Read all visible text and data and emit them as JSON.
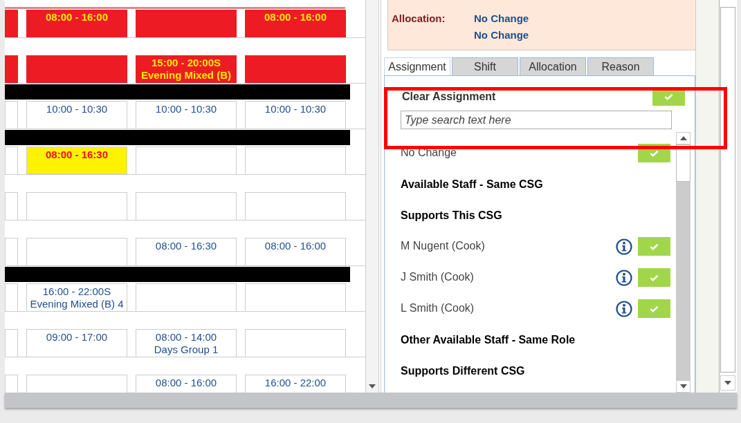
{
  "schedule": {
    "rows": [
      {
        "kind": "shift",
        "cells": [
          {
            "kind": "red"
          },
          {
            "kind": "red",
            "lines": [
              "08:00 - 16:00"
            ]
          },
          {
            "kind": "red"
          },
          {
            "kind": "red",
            "lines": [
              "08:00 - 16:00"
            ]
          }
        ]
      },
      {
        "kind": "shift",
        "cells": [
          {
            "kind": "red"
          },
          {
            "kind": "red"
          },
          {
            "kind": "red",
            "lines": [
              "15:00 - 20:00S",
              "Evening Mixed (B)"
            ]
          },
          {
            "kind": "red"
          }
        ]
      },
      {
        "kind": "divider"
      },
      {
        "kind": "shift",
        "cells": [
          {
            "kind": "plain"
          },
          {
            "kind": "plain",
            "lines": [
              "10:00 - 10:30"
            ]
          },
          {
            "kind": "plain",
            "lines": [
              "10:00 - 10:30"
            ]
          },
          {
            "kind": "plain",
            "lines": [
              "10:00 - 10:30"
            ]
          }
        ]
      },
      {
        "kind": "divider"
      },
      {
        "kind": "shift",
        "cells": [
          {
            "kind": "plain"
          },
          {
            "kind": "yellow",
            "lines": [
              "08:00 - 16:30"
            ]
          },
          {
            "kind": "plain"
          },
          {
            "kind": "plain"
          }
        ]
      },
      {
        "kind": "shift",
        "cells": [
          {
            "kind": "plain"
          },
          {
            "kind": "plain"
          },
          {
            "kind": "plain"
          },
          {
            "kind": "plain"
          }
        ]
      },
      {
        "kind": "shift",
        "cells": [
          {
            "kind": "plain"
          },
          {
            "kind": "plain"
          },
          {
            "kind": "plain",
            "lines": [
              "08:00 - 16:30"
            ]
          },
          {
            "kind": "plain",
            "lines": [
              "08:00 - 16:00"
            ]
          }
        ]
      },
      {
        "kind": "divider"
      },
      {
        "kind": "shift",
        "cells": [
          {
            "kind": "plain"
          },
          {
            "kind": "plain",
            "lines": [
              "16:00 - 22:00S",
              "Evening Mixed (B) 4"
            ]
          },
          {
            "kind": "plain"
          },
          {
            "kind": "plain"
          }
        ]
      },
      {
        "kind": "shift",
        "cells": [
          {
            "kind": "plain"
          },
          {
            "kind": "plain",
            "lines": [
              "09:00 - 17:00"
            ]
          },
          {
            "kind": "plain",
            "lines": [
              "08:00 - 14:00",
              "Days Group 1"
            ]
          },
          {
            "kind": "plain"
          }
        ]
      },
      {
        "kind": "shift",
        "cells": [
          {
            "kind": "plain"
          },
          {
            "kind": "plain"
          },
          {
            "kind": "plain",
            "lines": [
              "08:00 - 16:00"
            ]
          },
          {
            "kind": "plain",
            "lines": [
              "16:00 - 22:00"
            ]
          }
        ]
      }
    ]
  },
  "details": {
    "label": "Allocation:",
    "values": [
      "No Change",
      "No Change"
    ]
  },
  "tabs": [
    {
      "label": "Assignment",
      "selected": true
    },
    {
      "label": "Shift",
      "selected": false
    },
    {
      "label": "Allocation",
      "selected": false
    },
    {
      "label": "Reason",
      "selected": false
    }
  ],
  "assignment": {
    "title": "Clear Assignment",
    "search": {
      "placeholder": "Type search text here"
    },
    "items": [
      {
        "kind": "option",
        "label": "No Change"
      },
      {
        "kind": "heading",
        "label": "Available Staff - Same CSG"
      },
      {
        "kind": "heading",
        "label": "Supports This CSG"
      },
      {
        "kind": "staff",
        "label": "M Nugent (Cook)"
      },
      {
        "kind": "staff",
        "label": "J Smith (Cook)"
      },
      {
        "kind": "staff",
        "label": "L Smith (Cook)"
      },
      {
        "kind": "heading",
        "label": "Other Available Staff - Same Role"
      },
      {
        "kind": "heading",
        "label": "Supports Different CSG"
      }
    ]
  }
}
